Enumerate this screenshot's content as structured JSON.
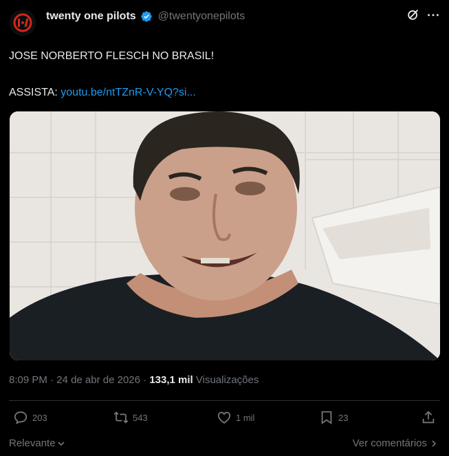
{
  "header": {
    "display_name": "twenty one pilots",
    "handle": "@twentyonepilots"
  },
  "post": {
    "line1": "JOSE NORBERTO FLESCH NO BRASIL!",
    "line2_prefix": "ASSISTA: ",
    "link_text": "youtu.be/ntTZnR-V-YQ?si..."
  },
  "meta": {
    "time": "8:09 PM",
    "sep1": " · ",
    "date": "24 de abr de 2026",
    "sep2": " · ",
    "views_count": "133,1 mil",
    "views_label": " Visualizações"
  },
  "actions": {
    "replies": "203",
    "reposts": "543",
    "likes": "1 mil",
    "bookmarks": "23"
  },
  "footer": {
    "sort_label": "Relevante",
    "view_comments": "Ver comentários"
  },
  "colors": {
    "background": "#000000",
    "text": "#e7e9ea",
    "muted": "#71767b",
    "link": "#1d9bf0",
    "verified": "#1d9bf0",
    "avatar_logo": "#d1281e"
  },
  "icons": [
    "band-logo-icon",
    "verified-badge-icon",
    "grok-icon",
    "more-options-icon",
    "reply-icon",
    "repost-icon",
    "like-icon",
    "bookmark-icon",
    "share-icon",
    "chevron-down-icon",
    "chevron-right-icon"
  ]
}
